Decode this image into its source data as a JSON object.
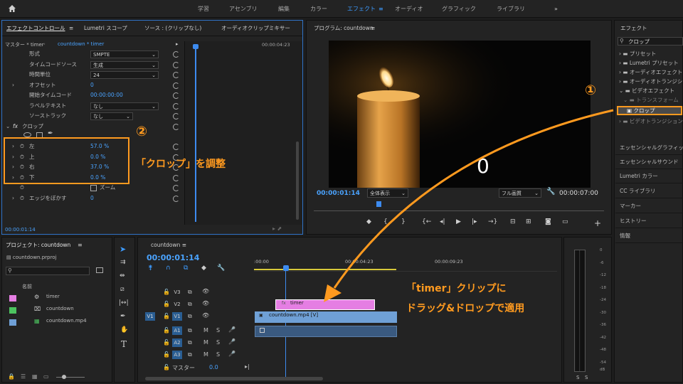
{
  "workspaces": [
    "学習",
    "アセンブリ",
    "編集",
    "カラー",
    "エフェクト",
    "オーディオ",
    "グラフィック",
    "ライブラリ"
  ],
  "active_workspace": "エフェクト",
  "effect_controls": {
    "tabs": [
      "エフェクトコントロール",
      "Lumetri スコープ",
      "ソース : (クリップなし)",
      "オーディオクリップミキサー"
    ],
    "source_label": "マスター * timer",
    "clip_label": "countdown * timer",
    "ruler_time": "00:00:04:23",
    "props": [
      {
        "label": "形式",
        "value": "SMPTE"
      },
      {
        "label": "タイムコードソース",
        "value": "生成"
      },
      {
        "label": "時間単位",
        "value": "24"
      },
      {
        "label": "オフセット",
        "value": "0"
      },
      {
        "label": "開始タイムコード",
        "value": "00:00:00:00"
      },
      {
        "label": "ラベルテキスト",
        "value": "なし"
      },
      {
        "label": "ソーストラック",
        "value": "なし"
      }
    ],
    "crop_label": "クロップ",
    "crop_params": [
      {
        "label": "左",
        "value": "57.0 %"
      },
      {
        "label": "上",
        "value": "0.0 %"
      },
      {
        "label": "右",
        "value": "37.0 %"
      },
      {
        "label": "下",
        "value": "0.0 %"
      }
    ],
    "zoom_label": "ズーム",
    "feather_label": "エッジをぼかす",
    "feather_value": "0",
    "current_time": "00:00:01:14"
  },
  "program": {
    "title": "プログラム: countdown",
    "overlay_text": "0",
    "timecode": "00:00:01:14",
    "fit": "全体表示",
    "quality": "フル画質",
    "duration": "00:00:07:00"
  },
  "effects_panel": {
    "title": "エフェクト",
    "search": "クロップ",
    "tree": [
      "プリセット",
      "Lumetri プリセット",
      "オーディオエフェクト",
      "オーディオトランジション",
      "ビデオエフェクト",
      "トランスフォーム"
    ],
    "highlighted": "クロップ",
    "below": "ビデオトランジション",
    "panels": [
      "エッセンシャルグラフィックス",
      "エッセンシャルサウンド",
      "Lumetri カラー",
      "CC ライブラリ",
      "マーカー",
      "ヒストリー",
      "情報"
    ]
  },
  "project": {
    "title": "プロジェクト: countdown",
    "file": "countdown.prproj",
    "column": "名前",
    "items": [
      {
        "name": "timer",
        "color": "#e57ee3"
      },
      {
        "name": "countdown",
        "color": "#4cc35f"
      },
      {
        "name": "countdown.mp4",
        "color": "#6fa0d6"
      }
    ]
  },
  "timeline": {
    "title": "countdown",
    "timecode": "00:00:01:14",
    "ruler": [
      ":00:00",
      "00:00:04:23",
      "00:00:09:23"
    ],
    "video_tracks": [
      "V3",
      "V2",
      "V1"
    ],
    "audio_tracks": [
      "A1",
      "A2",
      "A3"
    ],
    "source_v": "V1",
    "master_label": "マスター",
    "master_value": "0.0",
    "clip_timer": "timer",
    "clip_video": "countdown.mp4 [V]"
  },
  "meter_scale": [
    "0",
    "-6",
    "-12",
    "-18",
    "-24",
    "-30",
    "-36",
    "-42",
    "-48",
    "-54",
    "dB"
  ],
  "meter_solo": [
    "S",
    "S"
  ],
  "annotations": {
    "num1": "①",
    "num2": "②",
    "crop_adjust": "「クロップ」を調整",
    "drag_line1": "「timer」クリップに",
    "drag_line2": "ドラッグ&ドロップで適用"
  },
  "colors": {
    "accent": "#3d9bff",
    "annotation": "#ff9a1f",
    "timer_clip": "#e57ee3",
    "video_clip": "#6fa0d6"
  }
}
